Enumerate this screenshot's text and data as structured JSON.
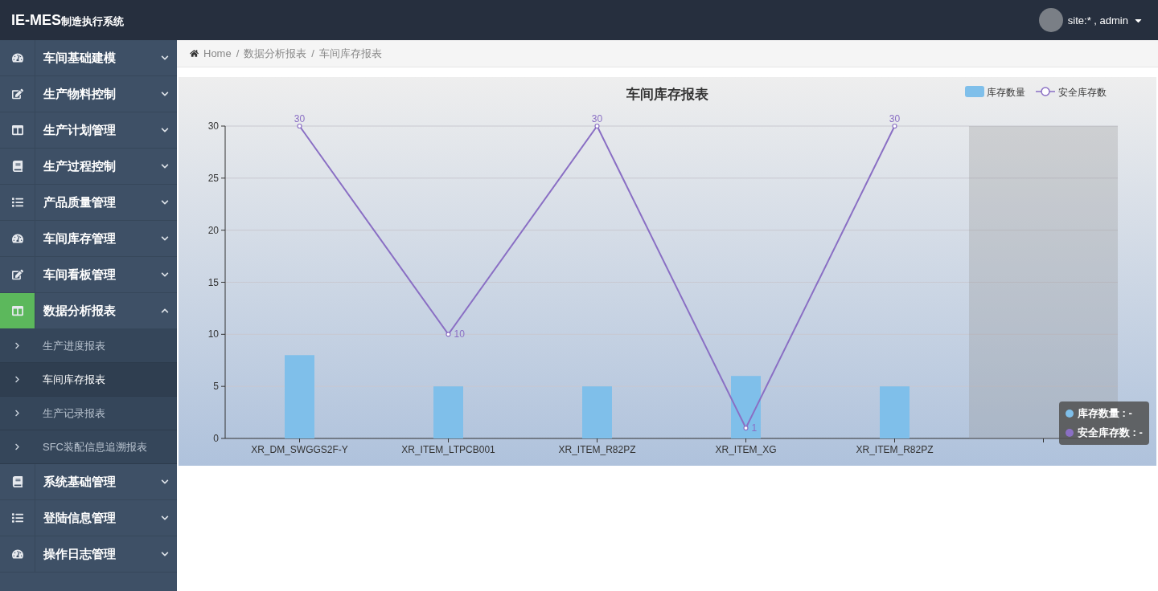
{
  "header": {
    "brand": "IE-MES",
    "brand_suffix": "制造执行系统",
    "user": "site:* , admin"
  },
  "sidebar": {
    "items": [
      {
        "label": "车间基础建模",
        "expanded": false,
        "selected": false
      },
      {
        "label": "生产物料控制",
        "expanded": false,
        "selected": false
      },
      {
        "label": "生产计划管理",
        "expanded": false,
        "selected": false
      },
      {
        "label": "生产过程控制",
        "expanded": false,
        "selected": false
      },
      {
        "label": "产品质量管理",
        "expanded": false,
        "selected": false
      },
      {
        "label": "车间库存管理",
        "expanded": false,
        "selected": false
      },
      {
        "label": "车间看板管理",
        "expanded": false,
        "selected": false
      },
      {
        "label": "数据分析报表",
        "expanded": true,
        "selected": true,
        "children": [
          {
            "label": "生产进度报表",
            "selected": false
          },
          {
            "label": "车间库存报表",
            "selected": true
          },
          {
            "label": "生产记录报表",
            "selected": false
          },
          {
            "label": "SFC装配信息追溯报表",
            "selected": false
          }
        ]
      },
      {
        "label": "系统基础管理",
        "expanded": false,
        "selected": false
      },
      {
        "label": "登陆信息管理",
        "expanded": false,
        "selected": false
      },
      {
        "label": "操作日志管理",
        "expanded": false,
        "selected": false
      }
    ]
  },
  "breadcrumb": {
    "separator": "/",
    "items": [
      "Home",
      "数据分析报表",
      "车间库存报表"
    ]
  },
  "report": {
    "chart_data": {
      "type": "bar",
      "title": "车间库存报表",
      "categories": [
        "XR_DM_SWGGS2F-Y",
        "XR_ITEM_LTPCB001",
        "XR_ITEM_R82PZ",
        "XR_ITEM_XG",
        "XR_ITEM_R82PZ",
        null
      ],
      "series": [
        {
          "name": "库存数量",
          "color": "#7fbfea",
          "type": "bar",
          "values": [
            8,
            5,
            5,
            6,
            5,
            null
          ]
        },
        {
          "name": "安全库存数",
          "color": "#8a6fc4",
          "type": "line",
          "marker": "circle",
          "values": [
            30,
            10,
            30,
            1,
            30,
            null
          ],
          "value_labels": [
            "30",
            "10",
            "30",
            "1",
            "30",
            null
          ]
        }
      ],
      "ylim": [
        0,
        30
      ],
      "yticks": [
        0,
        5,
        10,
        15,
        20,
        25,
        30
      ],
      "grid": true,
      "legend": "top-right"
    },
    "tooltip": [
      {
        "label": "库存数量 : -",
        "color": "#7fbfea"
      },
      {
        "label": "安全库存数 : -",
        "color": "#8a6fc4"
      }
    ]
  }
}
